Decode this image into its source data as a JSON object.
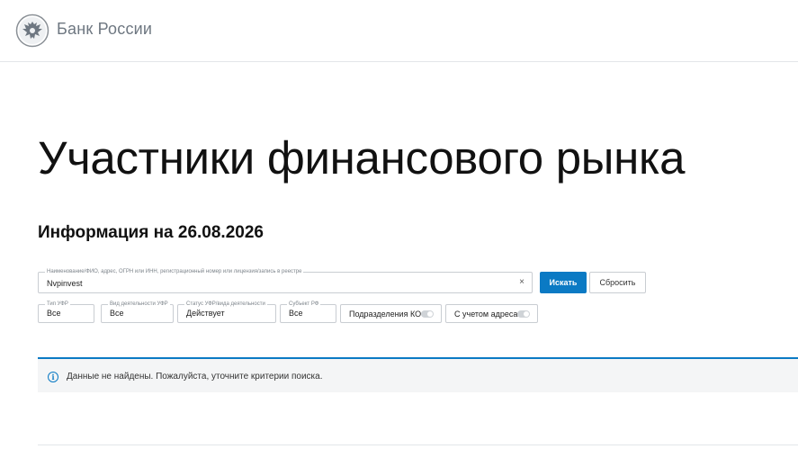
{
  "header": {
    "logo_icon": "double-headed-eagle-emblem",
    "logo_text": "Банк России"
  },
  "page": {
    "title": "Участники финансового рынка",
    "info_date": "Информация на 26.08.2026"
  },
  "search": {
    "legend": "Наименование/ФИО, адрес, ОГРН или ИНН, регистрационный номер или лицензия/запись в реестре",
    "value": "Nvpinvest",
    "clear_icon": "×",
    "search_button": "Искать",
    "reset_button": "Сбросить"
  },
  "filters": {
    "type": {
      "legend": "Тип УФР",
      "value": "Все"
    },
    "activity": {
      "legend": "Вид деятельности УФР",
      "value": "Все"
    },
    "status": {
      "legend": "Статус УФР/вида деятельности",
      "value": "Действует"
    },
    "subject": {
      "legend": "Субъект РФ",
      "value": "Все"
    },
    "toggle_branches": {
      "label": "Подразделения КО",
      "on": false
    },
    "toggle_address": {
      "label": "С учетом адреса",
      "on": false
    }
  },
  "notice": {
    "icon": "info-icon",
    "icon_glyph": "i",
    "message": "Данные не найдены. Пожалуйста, уточните критерии поиска.",
    "accent_color": "#0b7ac4"
  },
  "colors": {
    "primary": "#0b7ac4",
    "border": "#c9cdd2",
    "logo_text": "#6e7781"
  }
}
